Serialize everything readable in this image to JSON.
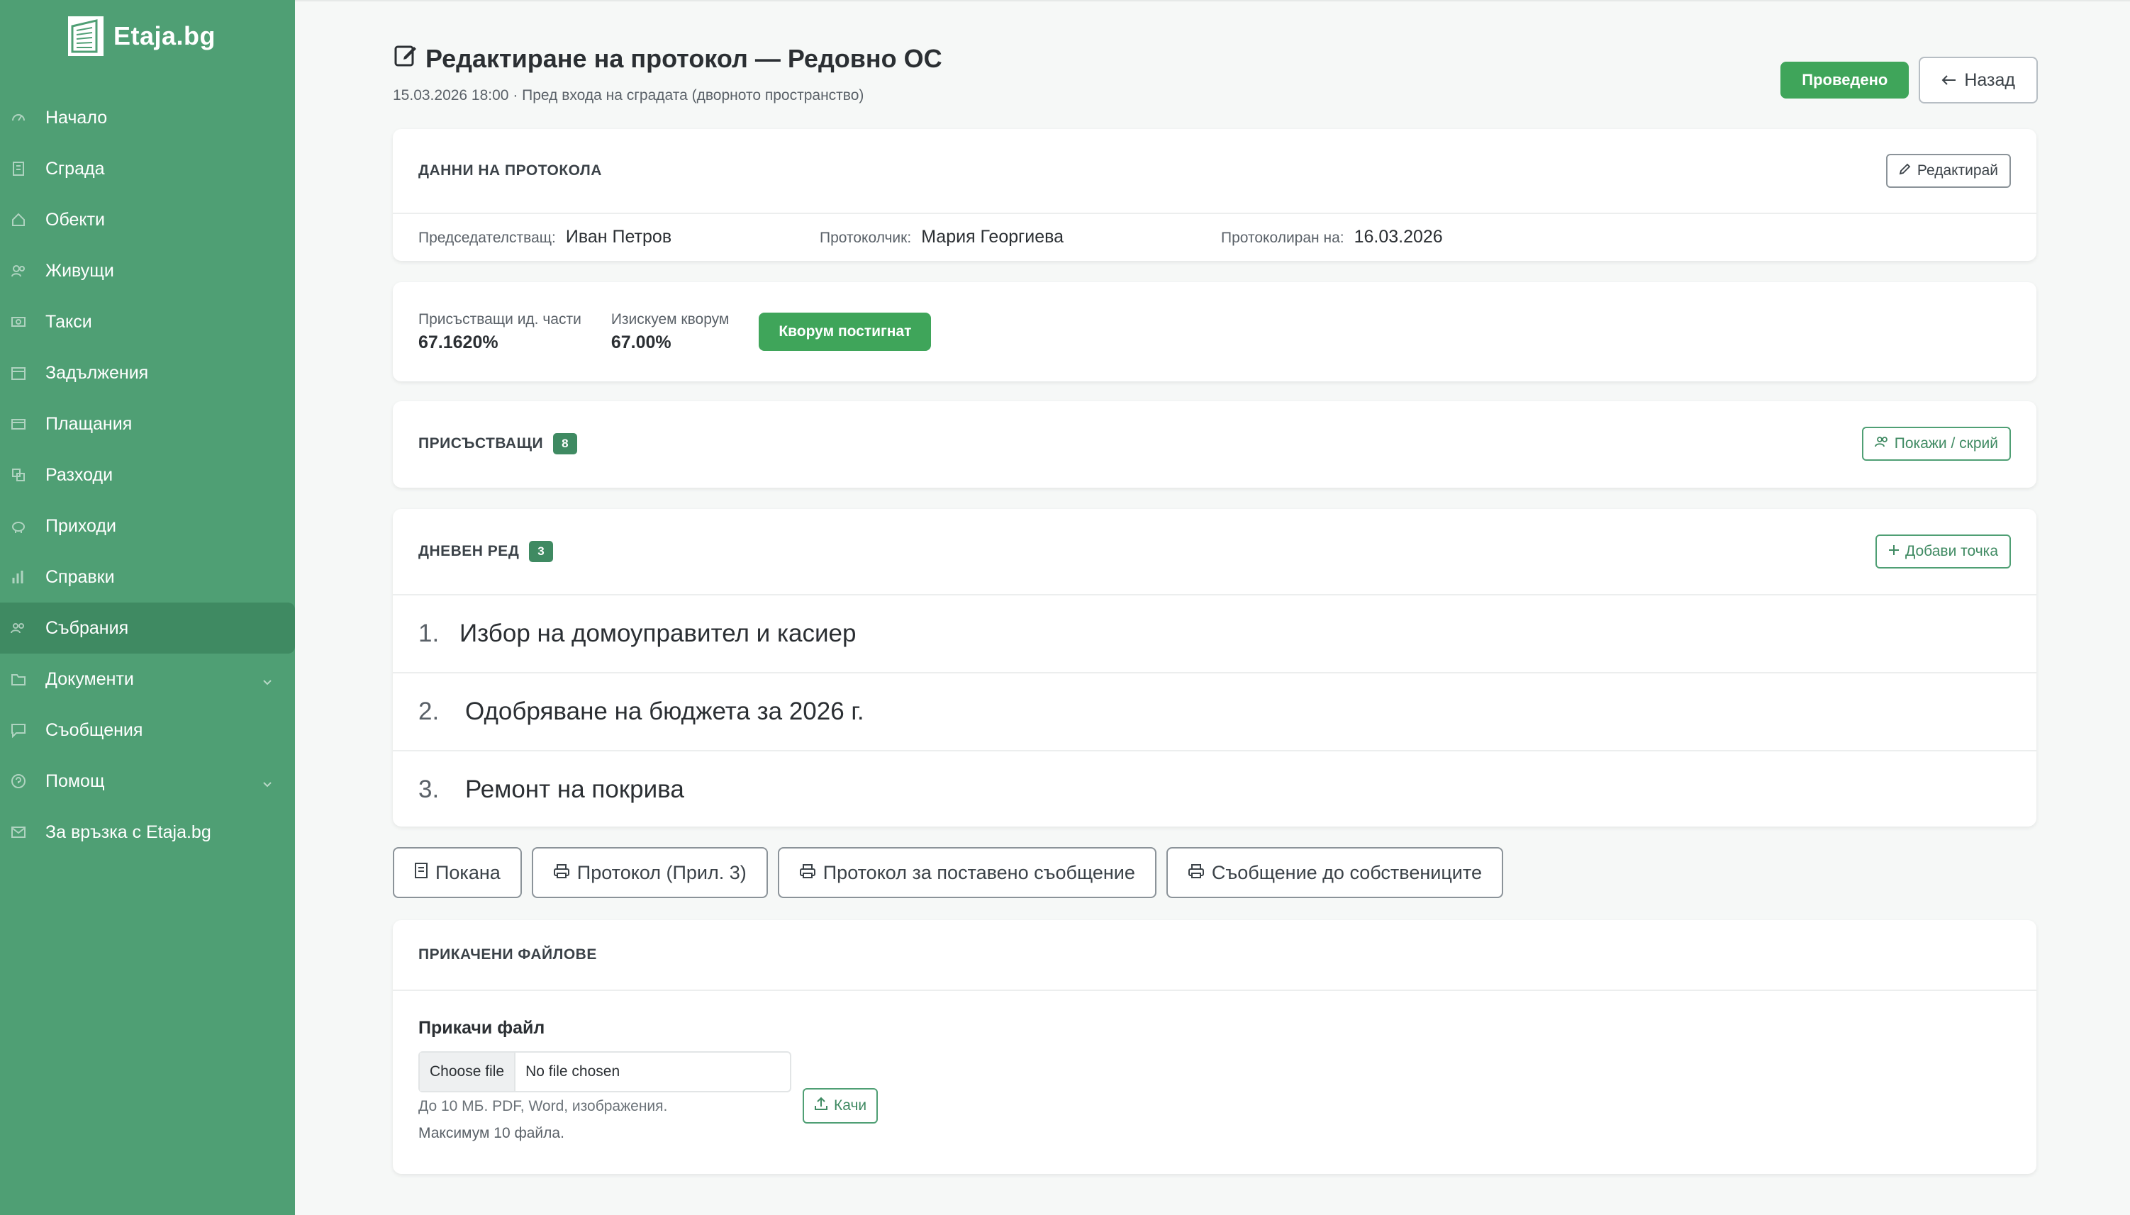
{
  "app": {
    "brand": "Etaja.bg"
  },
  "sidebar": {
    "items": [
      {
        "label": "Начало",
        "icon": "dashboard-icon"
      },
      {
        "label": "Сграда",
        "icon": "building-icon"
      },
      {
        "label": "Обекти",
        "icon": "home-icon"
      },
      {
        "label": "Живущи",
        "icon": "users-icon"
      },
      {
        "label": "Такси",
        "icon": "cash-icon"
      },
      {
        "label": "Задължения",
        "icon": "calendar-icon"
      },
      {
        "label": "Плащания",
        "icon": "credit-card-icon"
      },
      {
        "label": "Разходи",
        "icon": "exchange-icon"
      },
      {
        "label": "Приходи",
        "icon": "piggy-bank-icon"
      },
      {
        "label": "Справки",
        "icon": "bar-chart-icon"
      },
      {
        "label": "Събрания",
        "icon": "people-icon",
        "active": true
      },
      {
        "label": "Документи",
        "icon": "folder-icon",
        "expandable": true
      },
      {
        "label": "Съобщения",
        "icon": "message-icon"
      },
      {
        "label": "Помощ",
        "icon": "help-icon",
        "expandable": true
      },
      {
        "label": "За връзка с Etaja.bg",
        "icon": "mail-icon"
      }
    ]
  },
  "header": {
    "title": "Редактиране на протокол — Редовно ОС",
    "subtitle": "15.03.2026 18:00 · Пред входа на сградата (дворното пространство)",
    "status_badge": "Проведено",
    "back_label": "Назад"
  },
  "protocol": {
    "section_title": "ДАННИ НА ПРОТОКОЛА",
    "edit_label": "Редактирай",
    "chair_label": "Председателстващ:",
    "chair_value": "Иван Петров",
    "recorder_label": "Протоколчик:",
    "recorder_value": "Мария Георгиева",
    "recorded_on_label": "Протоколиран на:",
    "recorded_on_value": "16.03.2026"
  },
  "quorum": {
    "present_label": "Присъстващи ид. части",
    "present_value": "67.1620%",
    "required_label": "Изискуем кворум",
    "required_value": "67.00%",
    "status": "Кворум постигнат"
  },
  "attendees": {
    "section_title": "ПРИСЪСТВАЩИ",
    "count": "8",
    "toggle_label": "Покажи / скрий"
  },
  "agenda": {
    "section_title": "ДНЕВЕН РЕД",
    "count": "3",
    "add_label": "Добави точка",
    "items": [
      {
        "num": "1.",
        "text": "Избор на домоуправител и касиер"
      },
      {
        "num": "2.",
        "text": "Одобряване на бюджета за 2026 г."
      },
      {
        "num": "3.",
        "text": "Ремонт на покрива"
      }
    ]
  },
  "print_buttons": [
    {
      "label": "Покана",
      "icon": "document-icon"
    },
    {
      "label": "Протокол (Прил. 3)",
      "icon": "printer-icon"
    },
    {
      "label": "Протокол за поставено съобщение",
      "icon": "printer-icon"
    },
    {
      "label": "Съобщение до собствениците",
      "icon": "printer-icon"
    }
  ],
  "files": {
    "section_title": "ПРИКАЧЕНИ ФАЙЛОВЕ",
    "attach_label": "Прикачи файл",
    "choose_label": "Choose file",
    "no_file_label": "No file chosen",
    "upload_label": "Качи",
    "hint": "До 10 МБ. PDF, Word, изображения.",
    "max_note": "Максимум 10 файла."
  },
  "colors": {
    "sidebar_bg": "#4f9f74",
    "sidebar_active": "#3f8a62",
    "success": "#3fa55a",
    "accent_text": "#3f8a62"
  }
}
